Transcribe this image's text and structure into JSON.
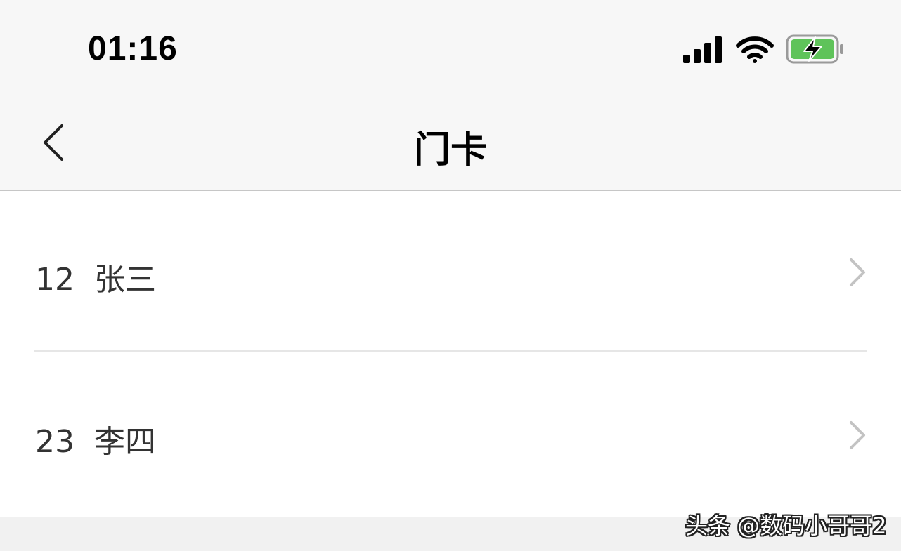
{
  "status_bar": {
    "time": "01:16",
    "icons": [
      "signal-icon",
      "wifi-icon",
      "battery-charging-icon"
    ],
    "battery_color": "#5fc35a"
  },
  "nav": {
    "back_icon": "chevron-left-icon",
    "title": "门卡"
  },
  "list": {
    "items": [
      {
        "label": "12  张三",
        "icon": "chevron-right-icon"
      },
      {
        "label": "23  李四",
        "icon": "chevron-right-icon"
      }
    ]
  },
  "watermark": {
    "text": "头条 @数码小哥哥2"
  }
}
